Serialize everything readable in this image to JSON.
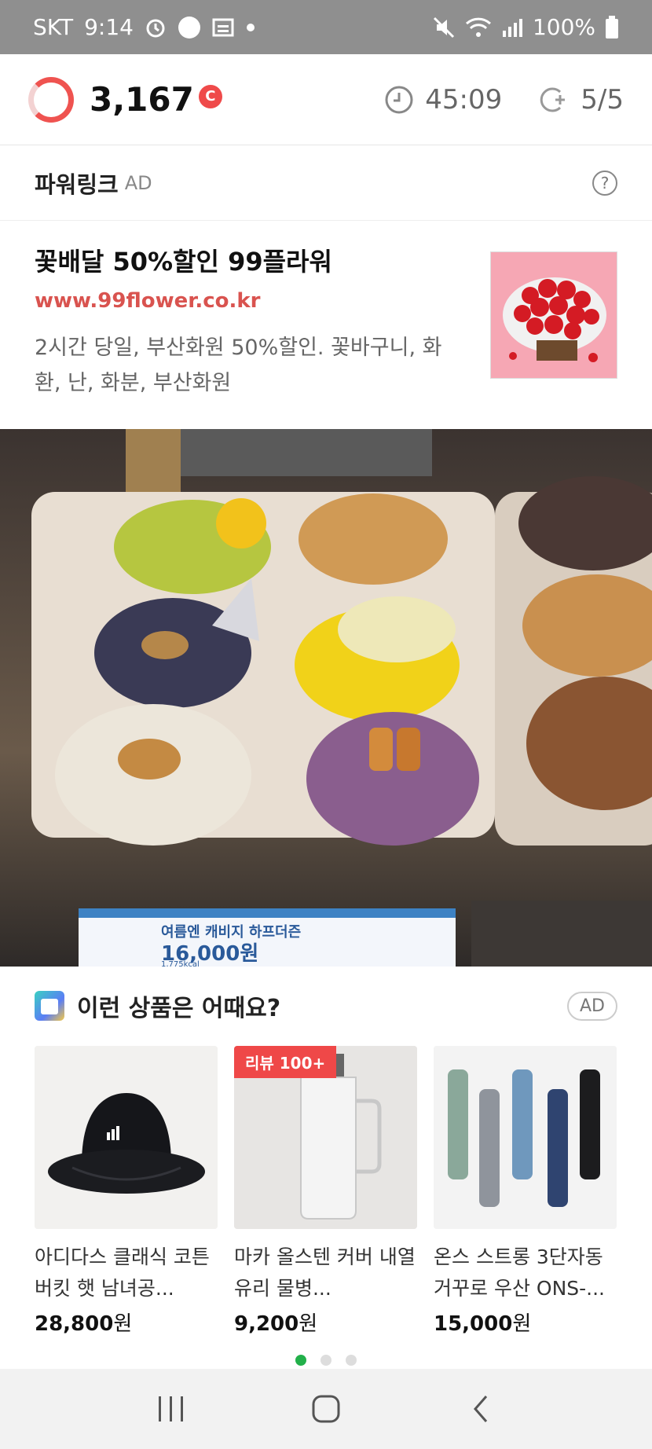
{
  "status_bar": {
    "carrier": "SKT",
    "time": "9:14",
    "battery": "100%"
  },
  "points_header": {
    "points": "3,167",
    "coin_symbol": "C",
    "timer": "45:09",
    "charges": "5/5",
    "ring_color": "#ef5350"
  },
  "powerlink": {
    "title": "파워링크",
    "ad_label": "AD",
    "help": "?"
  },
  "ad_card": {
    "title": "꽃배달 50%할인 99플라워",
    "url": "www.99flower.co.kr",
    "description": "2시간 당일, 부산화원 50%할인. 꽃바구니, 화환, 난, 화분, 부산화원"
  },
  "photo": {
    "price_sign_title": "여름엔 캐비지 하프더즌",
    "price_sign_price": "16,000원",
    "price_sign_kcal": "1,775kcal"
  },
  "recommend": {
    "title": "이런 상품은 어때요?",
    "ad_label": "AD",
    "products": [
      {
        "name": "아디다스 클래식 코튼 버킷 햇 남녀공...",
        "price": "28,800",
        "currency": "원",
        "badge": ""
      },
      {
        "name": "마카 올스텐 커버 내열유리 물병...",
        "price": "9,200",
        "currency": "원",
        "badge": "리뷰 100+"
      },
      {
        "name": "온스 스트롱 3단자동 거꾸로 우산 ONS-...",
        "price": "15,000",
        "currency": "원",
        "badge": ""
      }
    ],
    "page_dots": {
      "count": 3,
      "active": 1,
      "active_color": "#22b04a"
    }
  }
}
